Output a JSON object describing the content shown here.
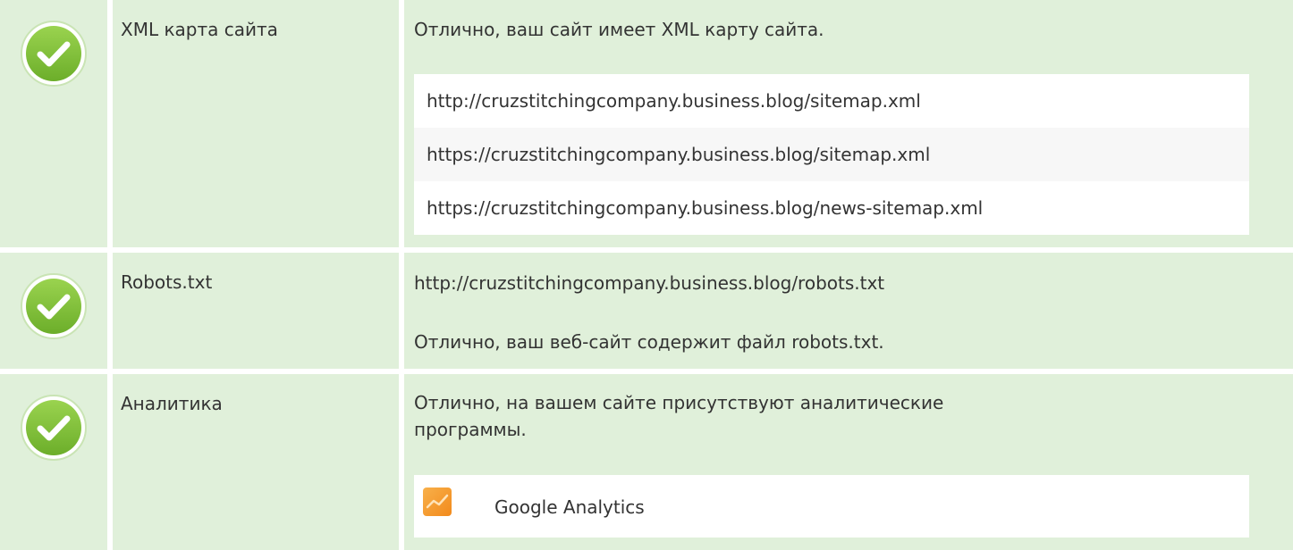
{
  "rows": [
    {
      "label": "XML карта сайта",
      "message": "Отлично, ваш сайт имеет XML карту сайта.",
      "sitemaps": [
        "http://cruzstitchingcompany.business.blog/sitemap.xml",
        "https://cruzstitchingcompany.business.blog/sitemap.xml",
        "https://cruzstitchingcompany.business.blog/news-sitemap.xml"
      ]
    },
    {
      "label": "Robots.txt",
      "url": "http://cruzstitchingcompany.business.blog/robots.txt",
      "message": "Отлично, ваш веб-сайт содержит файл robots.txt."
    },
    {
      "label": "Аналитика",
      "message": "Отлично, на вашем сайте присутствуют аналитические программы.",
      "tools": [
        "Google Analytics"
      ]
    }
  ],
  "icons": {
    "status": "check-circle-icon",
    "analytics_tool": "google-analytics-icon"
  },
  "colors": {
    "row_background": "#e0f0da",
    "check_green": "#7cbf3a",
    "check_border": "#9bd15b",
    "text": "#333333",
    "analytics_orange": "#f79d2a"
  }
}
